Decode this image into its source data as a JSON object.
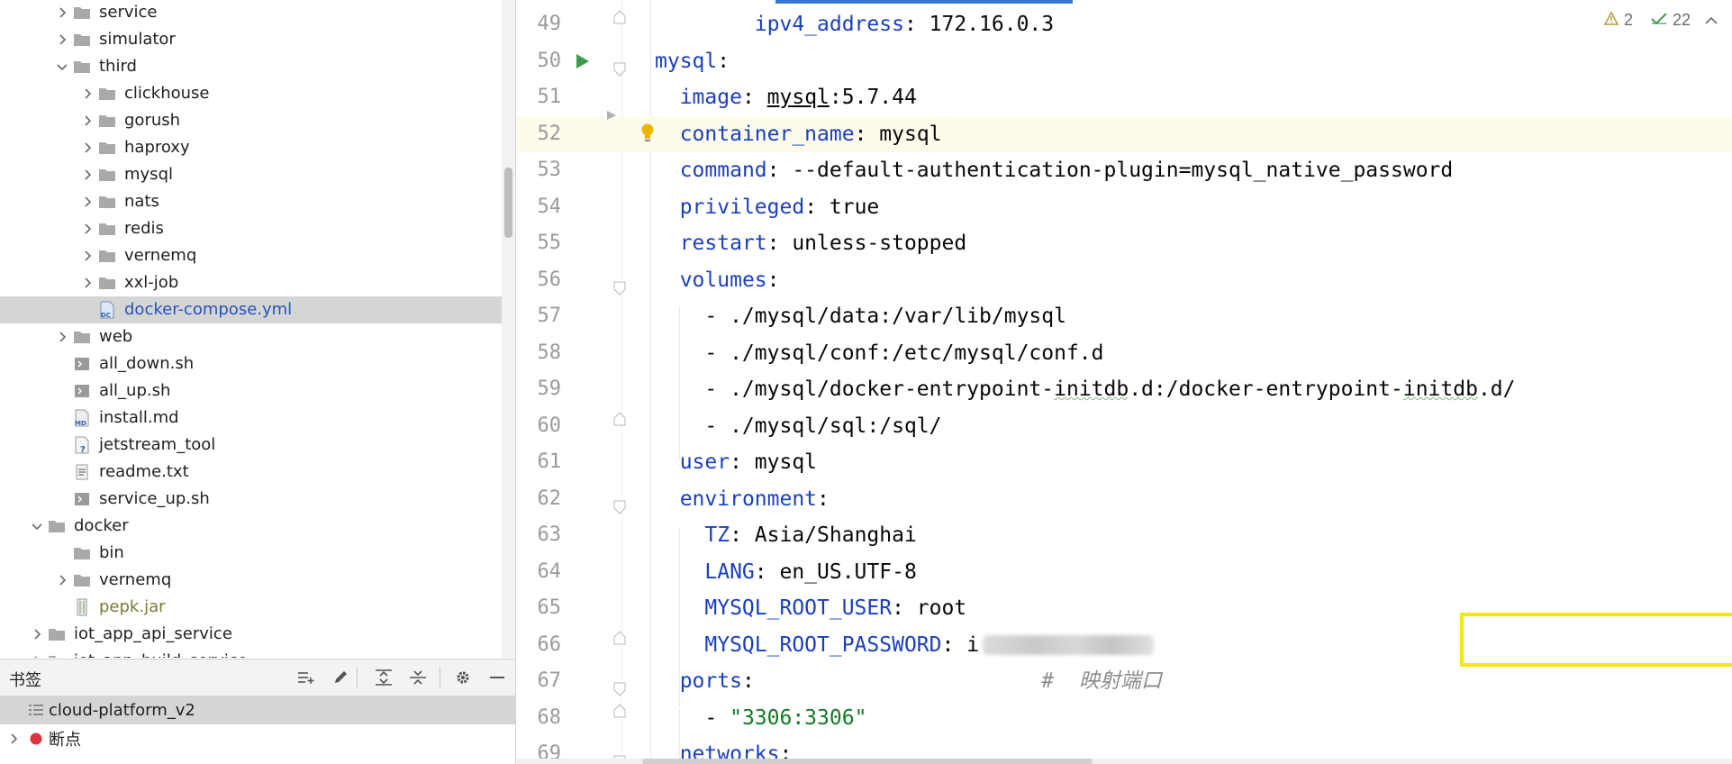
{
  "project_tree": {
    "items": [
      {
        "label": "service",
        "type": "folder",
        "chevron": "right"
      },
      {
        "label": "simulator",
        "type": "folder",
        "chevron": "right"
      },
      {
        "label": "third",
        "type": "folder",
        "chevron": "down"
      },
      {
        "label": "clickhouse",
        "type": "folder",
        "chevron": "right"
      },
      {
        "label": "gorush",
        "type": "folder",
        "chevron": "right"
      },
      {
        "label": "haproxy",
        "type": "folder",
        "chevron": "right"
      },
      {
        "label": "mysql",
        "type": "folder",
        "chevron": "right"
      },
      {
        "label": "nats",
        "type": "folder",
        "chevron": "right"
      },
      {
        "label": "redis",
        "type": "folder",
        "chevron": "right"
      },
      {
        "label": "vernemq",
        "type": "folder",
        "chevron": "right"
      },
      {
        "label": "xxl-job",
        "type": "folder",
        "chevron": "right"
      },
      {
        "label": "docker-compose.yml",
        "type": "docker-compose",
        "chevron": "none",
        "selected": true
      },
      {
        "label": "web",
        "type": "folder",
        "chevron": "right"
      },
      {
        "label": "all_down.sh",
        "type": "shell",
        "chevron": "none"
      },
      {
        "label": "all_up.sh",
        "type": "shell",
        "chevron": "none"
      },
      {
        "label": "install.md",
        "type": "markdown",
        "chevron": "none"
      },
      {
        "label": "jetstream_tool",
        "type": "unknown",
        "chevron": "none"
      },
      {
        "label": "readme.txt",
        "type": "text",
        "chevron": "none"
      },
      {
        "label": "service_up.sh",
        "type": "shell",
        "chevron": "none"
      },
      {
        "label": "docker",
        "type": "folder",
        "chevron": "down"
      },
      {
        "label": "bin",
        "type": "folder",
        "chevron": "none"
      },
      {
        "label": "vernemq",
        "type": "folder",
        "chevron": "right"
      },
      {
        "label": "pepk.jar",
        "type": "jar",
        "chevron": "none"
      },
      {
        "label": "iot_app_api_service",
        "type": "folder",
        "chevron": "right"
      },
      {
        "label": "iot_app_build_service",
        "type": "folder",
        "chevron": "right"
      }
    ]
  },
  "bookmarks": {
    "title": "书签",
    "tools": [
      "add-to-list-icon",
      "edit-icon",
      "expand-all-icon",
      "collapse-all-icon",
      "settings-gear-icon",
      "minimize-icon"
    ],
    "items": [
      {
        "label": "cloud-platform_v2",
        "icon": "list-icon"
      },
      {
        "label": "断点",
        "icon": "breakpoint-icon"
      }
    ]
  },
  "editor": {
    "inspections": {
      "warnings": "2",
      "ok": "22"
    },
    "lines": [
      {
        "n": "49",
        "fold": "end",
        "tokens": [
          {
            "t": "        "
          },
          {
            "t": "ipv4_address",
            "c": "k"
          },
          {
            "t": ": 172.16.0.3"
          }
        ]
      },
      {
        "n": "50",
        "fold": "start",
        "run": true,
        "tokens": [
          {
            "t": "mysql",
            "c": "k"
          },
          {
            "t": ":"
          }
        ]
      },
      {
        "n": "51",
        "tokens": [
          {
            "t": "  "
          },
          {
            "t": "image",
            "c": "k"
          },
          {
            "t": ": "
          },
          {
            "t": "mysql",
            "c": "u"
          },
          {
            "t": ":5.7.44"
          }
        ]
      },
      {
        "n": "52",
        "current": true,
        "bulb": true,
        "tokens": [
          {
            "t": "  "
          },
          {
            "t": "container_name",
            "c": "k"
          },
          {
            "t": ": mysql"
          }
        ]
      },
      {
        "n": "53",
        "tokens": [
          {
            "t": "  "
          },
          {
            "t": "command",
            "c": "k"
          },
          {
            "t": ": --default-authentication-plugin=mysql_native_password"
          }
        ]
      },
      {
        "n": "54",
        "tokens": [
          {
            "t": "  "
          },
          {
            "t": "privileged",
            "c": "k"
          },
          {
            "t": ": true"
          }
        ]
      },
      {
        "n": "55",
        "tokens": [
          {
            "t": "  "
          },
          {
            "t": "restart",
            "c": "k"
          },
          {
            "t": ": unless-stopped"
          }
        ]
      },
      {
        "n": "56",
        "fold": "start",
        "tokens": [
          {
            "t": "  "
          },
          {
            "t": "volumes",
            "c": "k"
          },
          {
            "t": ":"
          }
        ]
      },
      {
        "n": "57",
        "tokens": [
          {
            "t": "    - ./mysql/data:/var/lib/mysql"
          }
        ]
      },
      {
        "n": "58",
        "tokens": [
          {
            "t": "    - ./mysql/conf:/etc/mysql/conf.d"
          }
        ]
      },
      {
        "n": "59",
        "tokens": [
          {
            "t": "    - ./mysql/docker-entrypoint-"
          },
          {
            "t": "initdb",
            "c": "sq"
          },
          {
            "t": ".d:/docker-entrypoint-"
          },
          {
            "t": "initdb",
            "c": "sq"
          },
          {
            "t": ".d/"
          }
        ]
      },
      {
        "n": "60",
        "fold": "end",
        "tokens": [
          {
            "t": "    - ./mysql/sql:/sql/"
          }
        ]
      },
      {
        "n": "61",
        "tokens": [
          {
            "t": "  "
          },
          {
            "t": "user",
            "c": "k"
          },
          {
            "t": ": mysql"
          }
        ]
      },
      {
        "n": "62",
        "fold": "start",
        "tokens": [
          {
            "t": "  "
          },
          {
            "t": "environment",
            "c": "k"
          },
          {
            "t": ":"
          }
        ]
      },
      {
        "n": "63",
        "tokens": [
          {
            "t": "    "
          },
          {
            "t": "TZ",
            "c": "k"
          },
          {
            "t": ": Asia/Shanghai"
          }
        ]
      },
      {
        "n": "64",
        "tokens": [
          {
            "t": "    "
          },
          {
            "t": "LANG",
            "c": "k"
          },
          {
            "t": ": en_US.UTF-8"
          }
        ]
      },
      {
        "n": "65",
        "tokens": [
          {
            "t": "    "
          },
          {
            "t": "MYSQL_ROOT_USER",
            "c": "k"
          },
          {
            "t": ": root"
          }
        ]
      },
      {
        "n": "66",
        "fold": "end",
        "redacted": true,
        "tokens": [
          {
            "t": "    "
          },
          {
            "t": "MYSQL_ROOT_PASSWORD",
            "c": "k"
          },
          {
            "t": ": i"
          }
        ]
      },
      {
        "n": "67",
        "fold": "start",
        "tokens": [
          {
            "t": "  "
          },
          {
            "t": "ports",
            "c": "k"
          },
          {
            "t": ":                       "
          },
          {
            "t": "#  映射端口",
            "c": "c"
          }
        ]
      },
      {
        "n": "68",
        "fold": "end",
        "tokens": [
          {
            "t": "    - "
          },
          {
            "t": "\"3306:3306\"",
            "c": "s"
          }
        ]
      },
      {
        "n": "69",
        "fold": "start",
        "tokens": [
          {
            "t": "  "
          },
          {
            "t": "networks",
            "c": "k"
          },
          {
            "t": ":"
          }
        ]
      }
    ]
  }
}
